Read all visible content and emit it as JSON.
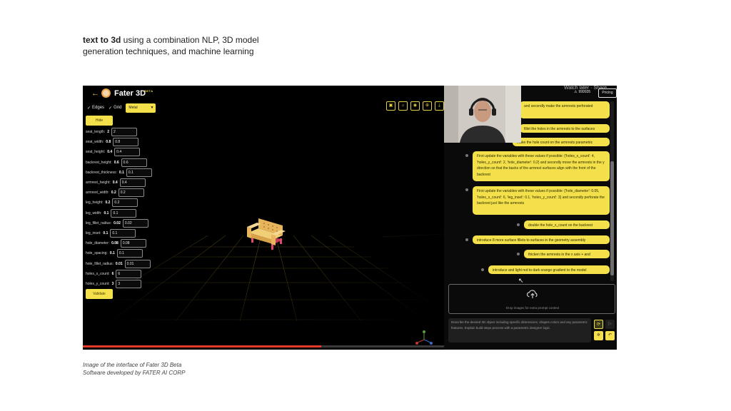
{
  "headline": {
    "bold": "text to 3d",
    "rest": " using a combination NLP, 3D model generation techniques, and machine learning"
  },
  "caption": {
    "line1": "Image of the interface of Fater 3D Beta",
    "line2": "Software developed by FATER AI CORP"
  },
  "app": {
    "back_icon": "back-arrow-icon",
    "brand": "Fater 3D",
    "beta": "BETA",
    "edges_label": "Edges",
    "grid_label": "Grid",
    "material_select": "Metal",
    "hide_button": "Hide",
    "validate_button": "Validate",
    "params": [
      {
        "name": "seat_length:",
        "value": "2",
        "input": "2"
      },
      {
        "name": "seat_width:",
        "value": "0.8",
        "input": "0.8"
      },
      {
        "name": "seat_height:",
        "value": "0.4",
        "input": "0.4"
      },
      {
        "name": "backrest_height:",
        "value": "0.6",
        "input": "0.6"
      },
      {
        "name": "backrest_thickness:",
        "value": "0.1",
        "input": "0.1"
      },
      {
        "name": "armrest_height:",
        "value": "0.4",
        "input": "0.4"
      },
      {
        "name": "armrest_width:",
        "value": "0.2",
        "input": "0.2"
      },
      {
        "name": "leg_height:",
        "value": "0.2",
        "input": "0.2"
      },
      {
        "name": "leg_width:",
        "value": "0.1",
        "input": "0.1"
      },
      {
        "name": "leg_fillet_radius:",
        "value": "0.02",
        "input": "0.02"
      },
      {
        "name": "leg_inset:",
        "value": "0.1",
        "input": "0.1"
      },
      {
        "name": "hole_diameter:",
        "value": "0.08",
        "input": "0.08"
      },
      {
        "name": "hole_spacing:",
        "value": "0.1",
        "input": "0.1"
      },
      {
        "name": "hole_fillet_radius:",
        "value": "0.01",
        "input": "0.01"
      },
      {
        "name": "holes_x_count:",
        "value": "6",
        "input": "6"
      },
      {
        "name": "holes_y_count:",
        "value": "3",
        "input": "3"
      }
    ],
    "toolbar_icons": [
      "save-icon",
      "home-icon",
      "camera-icon",
      "globe-icon",
      "download-icon"
    ],
    "progress_fraction": 0.66
  },
  "panel": {
    "header_fragment": "Watch later · Share",
    "credits": "999935",
    "pricing": "Pricing",
    "messages": [
      {
        "text": "and secondly make the armrests perforated"
      },
      {
        "text": "fillet the holes in the armrests to the surfaces"
      },
      {
        "text": "make the hole count on the armrests parametric"
      },
      {
        "text": "First update the variables with these values if possible: {'holes_x_count': 4, 'holes_y_count': 2, 'hole_diameter': 0.2} and secondly move the armrests in the y direction so that the backs of the armrest surfaces align with the front of the backrest"
      },
      {
        "text": "First update the variables with these values if possible: {'hole_diameter': 0.05, 'holes_x_count': 6, 'leg_inset': 0.1, 'holes_y_count': 3} and secondly perforate the backrest just like the armrests"
      },
      {
        "text": "double the hole_x_count on the backrest"
      },
      {
        "text": "introduce 8 more surface fillets to surfaces in the geometry assembly"
      },
      {
        "text": "thicken the armrests in the x axis + and"
      },
      {
        "text": "introduce and light red to dark orange gradient to the model"
      }
    ],
    "drop_text": "Drop images for extra prompt context",
    "prompt_placeholder": "Describe the desired 3D object including specific dimensions, shapes colors and any parametric features. Explain build steps process with a parametric designer logic."
  },
  "colors": {
    "accent_yellow": "#f3e04b",
    "background": "#000000",
    "sofa_body": "#e8b85a",
    "sofa_base": "#e0486a",
    "progress": "#e23b2c"
  }
}
